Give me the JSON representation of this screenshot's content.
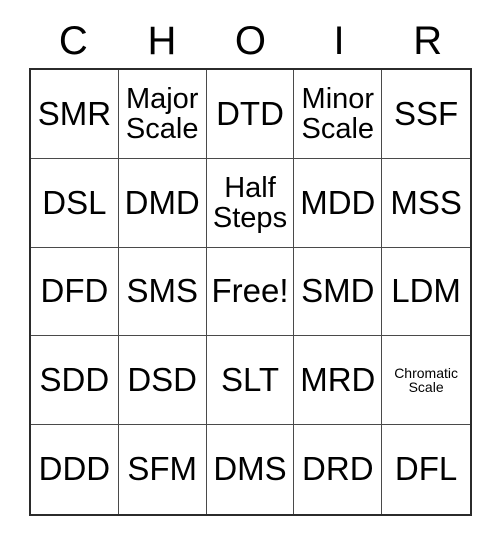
{
  "card": {
    "title_letters": [
      "C",
      "H",
      "O",
      "I",
      "R"
    ],
    "grid": {
      "rows": 5,
      "columns": 5,
      "cells": [
        {
          "text": "SMR",
          "size": "large"
        },
        {
          "text": "Major Scale",
          "size": "medium"
        },
        {
          "text": "DTD",
          "size": "large"
        },
        {
          "text": "Minor Scale",
          "size": "medium"
        },
        {
          "text": "SSF",
          "size": "large"
        },
        {
          "text": "DSL",
          "size": "large"
        },
        {
          "text": "DMD",
          "size": "large"
        },
        {
          "text": "Half Steps",
          "size": "medium"
        },
        {
          "text": "MDD",
          "size": "large"
        },
        {
          "text": "MSS",
          "size": "large"
        },
        {
          "text": "DFD",
          "size": "large"
        },
        {
          "text": "SMS",
          "size": "large"
        },
        {
          "text": "Free!",
          "size": "large"
        },
        {
          "text": "SMD",
          "size": "large"
        },
        {
          "text": "LDM",
          "size": "large"
        },
        {
          "text": "SDD",
          "size": "large"
        },
        {
          "text": "DSD",
          "size": "large"
        },
        {
          "text": "SLT",
          "size": "large"
        },
        {
          "text": "MRD",
          "size": "large"
        },
        {
          "text": "Chromatic Scale",
          "size": "small"
        },
        {
          "text": "DDD",
          "size": "large"
        },
        {
          "text": "SFM",
          "size": "large"
        },
        {
          "text": "DMS",
          "size": "large"
        },
        {
          "text": "DRD",
          "size": "large"
        },
        {
          "text": "DFL",
          "size": "large"
        }
      ]
    },
    "colors": {
      "background": "#ffffff",
      "text": "#000000",
      "grid_outer_border": "#2b2b2b",
      "grid_inner_border": "#4a4a4a"
    }
  }
}
